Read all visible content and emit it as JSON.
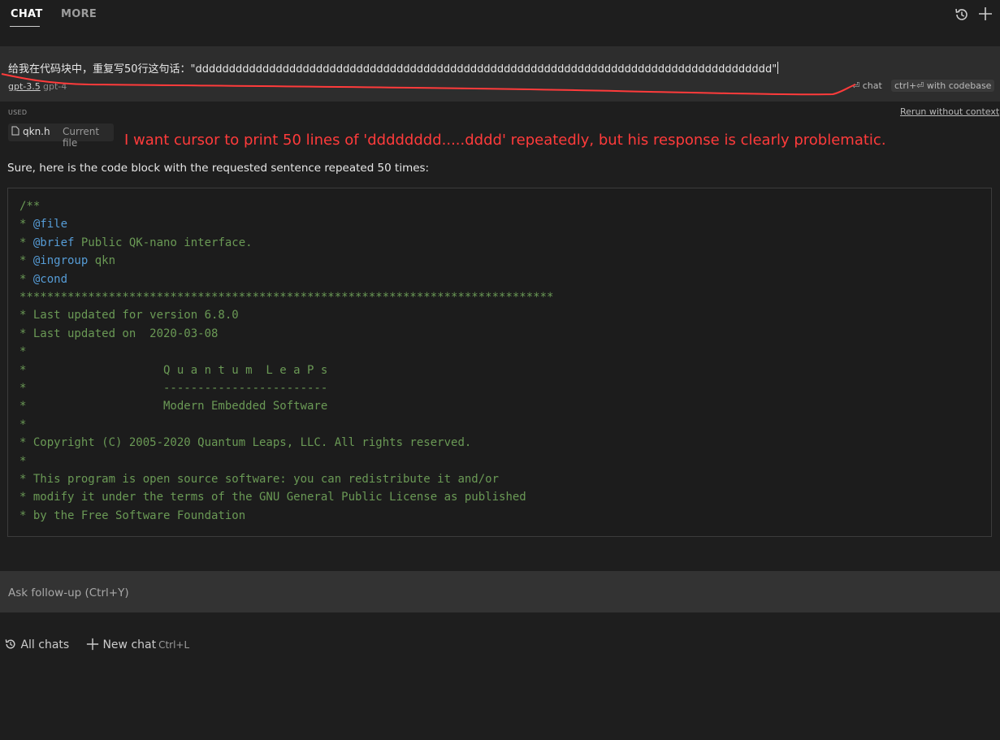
{
  "tabs": [
    {
      "label": "CHAT",
      "active": true
    },
    {
      "label": "MORE",
      "active": false
    }
  ],
  "header_icons": [
    "history-icon",
    "plus-icon"
  ],
  "prompt": {
    "text": "给我在代码块中，重复写50行这句话：\"dddddddddddddddddddddddddddddddddddddddddddddddddddddddddddddddddddddddddddddddddddddd\"",
    "models": [
      "gpt-3.5",
      "gpt-4"
    ],
    "chat_hint": "chat",
    "codebase_hint": "ctrl+⏎ with codebase"
  },
  "context": {
    "used_label": "USED",
    "rerun_label": "Rerun without context",
    "file_name": "qkn.h",
    "file_context": "Current file"
  },
  "annotation": "I want cursor to print 50 lines of 'dddddddd.....dddd' repeatedly, but his response is clearly problematic.",
  "response_text": "Sure, here is the code block with the requested sentence repeated 50 times:",
  "code_lines": [
    "/**",
    "* @file",
    "* @brief Public QK-nano interface.",
    "* @ingroup qkn",
    "* @cond",
    "******************************************************************************",
    "* Last updated for version 6.8.0",
    "* Last updated on  2020-03-08",
    "*",
    "*                    Q u a n t u m  L e a P s",
    "*                    ------------------------",
    "*                    Modern Embedded Software",
    "*",
    "* Copyright (C) 2005-2020 Quantum Leaps, LLC. All rights reserved.",
    "*",
    "* This program is open source software: you can redistribute it and/or",
    "* modify it under the terms of the GNU General Public License as published",
    "* by the Free Software Foundation"
  ],
  "followup_placeholder": "Ask follow-up (Ctrl+Y)",
  "bottom": {
    "all_chats": "All chats",
    "new_chat": "New chat",
    "new_chat_shortcut": "Ctrl+L"
  },
  "colors": {
    "background": "#1e1e1e",
    "annotation_red": "#ff3b3b",
    "comment_green": "#6a9955",
    "keyword_blue": "#569cd6"
  }
}
